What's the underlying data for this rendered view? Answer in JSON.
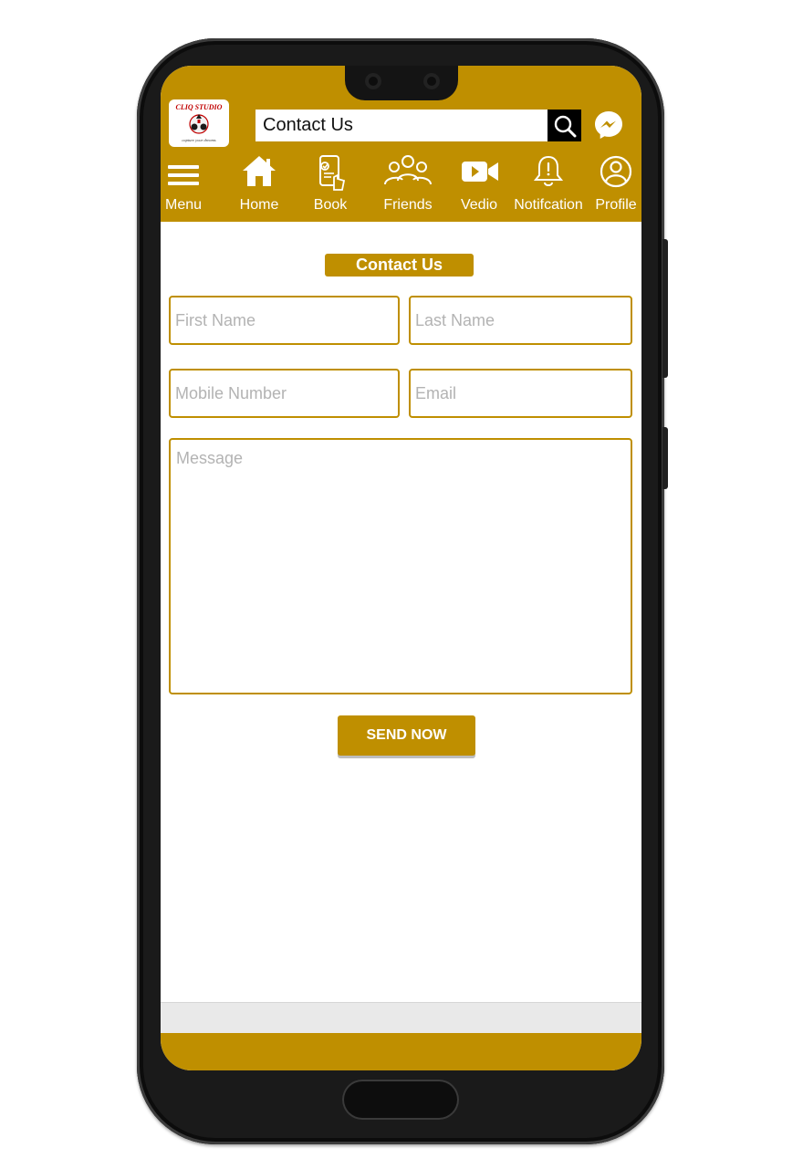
{
  "brand": {
    "logo_text": "CLIQ STUDIO",
    "logo_tagline": "capture your dreams",
    "accent_color": "#bf8f00"
  },
  "search": {
    "value": "Contact Us",
    "icon": "search-icon"
  },
  "messenger": {
    "icon": "messenger-icon"
  },
  "nav": {
    "items": [
      {
        "label": "Menu",
        "icon": "menu-icon"
      },
      {
        "label": "Home",
        "icon": "home-icon"
      },
      {
        "label": "Book",
        "icon": "book-icon"
      },
      {
        "label": "Friends",
        "icon": "friends-icon"
      },
      {
        "label": "Vedio",
        "icon": "video-icon"
      },
      {
        "label": "Notifcation",
        "icon": "bell-icon"
      },
      {
        "label": "Profile",
        "icon": "profile-icon"
      }
    ]
  },
  "form": {
    "title": "Contact Us",
    "first_name_placeholder": "First Name",
    "last_name_placeholder": "Last Name",
    "mobile_placeholder": "Mobile Number",
    "email_placeholder": "Email",
    "message_placeholder": "Message",
    "submit_label": "SEND NOW"
  }
}
